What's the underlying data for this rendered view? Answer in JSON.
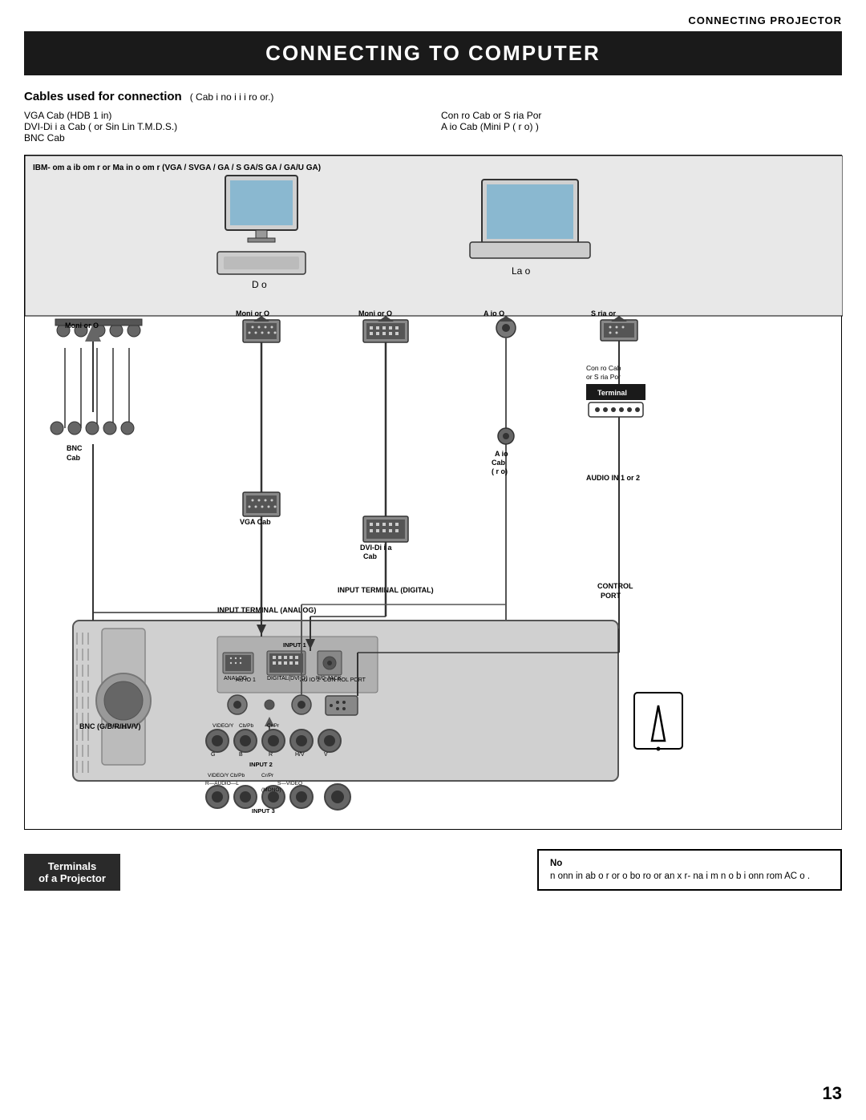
{
  "header": {
    "title": "CONNECTING PROJECTOR"
  },
  "main_title": "CONNECTING TO COMPUTER",
  "cables": {
    "title": "Cables used for connection",
    "subtitle": "( Cab i no  i  i  i ro  or.)",
    "items_left": [
      "VGA Cab  (HDB 1  in)",
      "DVI-Di i a Cab  ( or Sin  Lin T.M.D.S.)",
      "BNC Cab"
    ],
    "items_right": [
      "Con ro Cab  or S ria Por",
      "A  io Cab  (Mini P  (  r o) )"
    ]
  },
  "diagram": {
    "computer_label": "IBM- om a ib  om  r or Ma in o  om  r (VGA / SVGA /  GA / S  GA/S  GA /   GA/U  GA)",
    "desktop_label": "D  o",
    "laptop_label": "La o",
    "connectors": [
      {
        "label": "Moni or O",
        "position": "left-top"
      },
      {
        "label": "Moni or O",
        "position": "center-left"
      },
      {
        "label": "Moni or O",
        "position": "center-right"
      },
      {
        "label": "A  io O",
        "position": "right-center"
      },
      {
        "label": "S ria  or",
        "position": "right-top"
      }
    ],
    "cables": [
      {
        "label": "BNC Cab",
        "position": "left"
      },
      {
        "label": "VGA Cab",
        "position": "center-left"
      },
      {
        "label": "DVI-Di i a Cab",
        "position": "center"
      },
      {
        "label": "A  io Cab\n(  r o)",
        "position": "center-right"
      },
      {
        "label": "Con ro Cab\nor S ria Por",
        "position": "right"
      }
    ],
    "terminal_label": "Terminal",
    "input_terminal_analog": "INPUT TERMINAL (ANALOG)",
    "input_terminal_digital": "INPUT TERMINAL (DIGITAL)",
    "audio_in": "AUDIO IN 1 or 2",
    "control_port": "CONTROL\nPORT",
    "bnc_label": "BNC (G/B/R/HV/V)"
  },
  "terminals_box": {
    "line1": "Terminals",
    "line2": "of a Projector"
  },
  "note": {
    "title": "No",
    "text": "n  onn in  ab  o r  or  o bo  ro  or an  x r- na  i m n  o  b  i onn  rom AC o  ."
  },
  "page_number": "13"
}
